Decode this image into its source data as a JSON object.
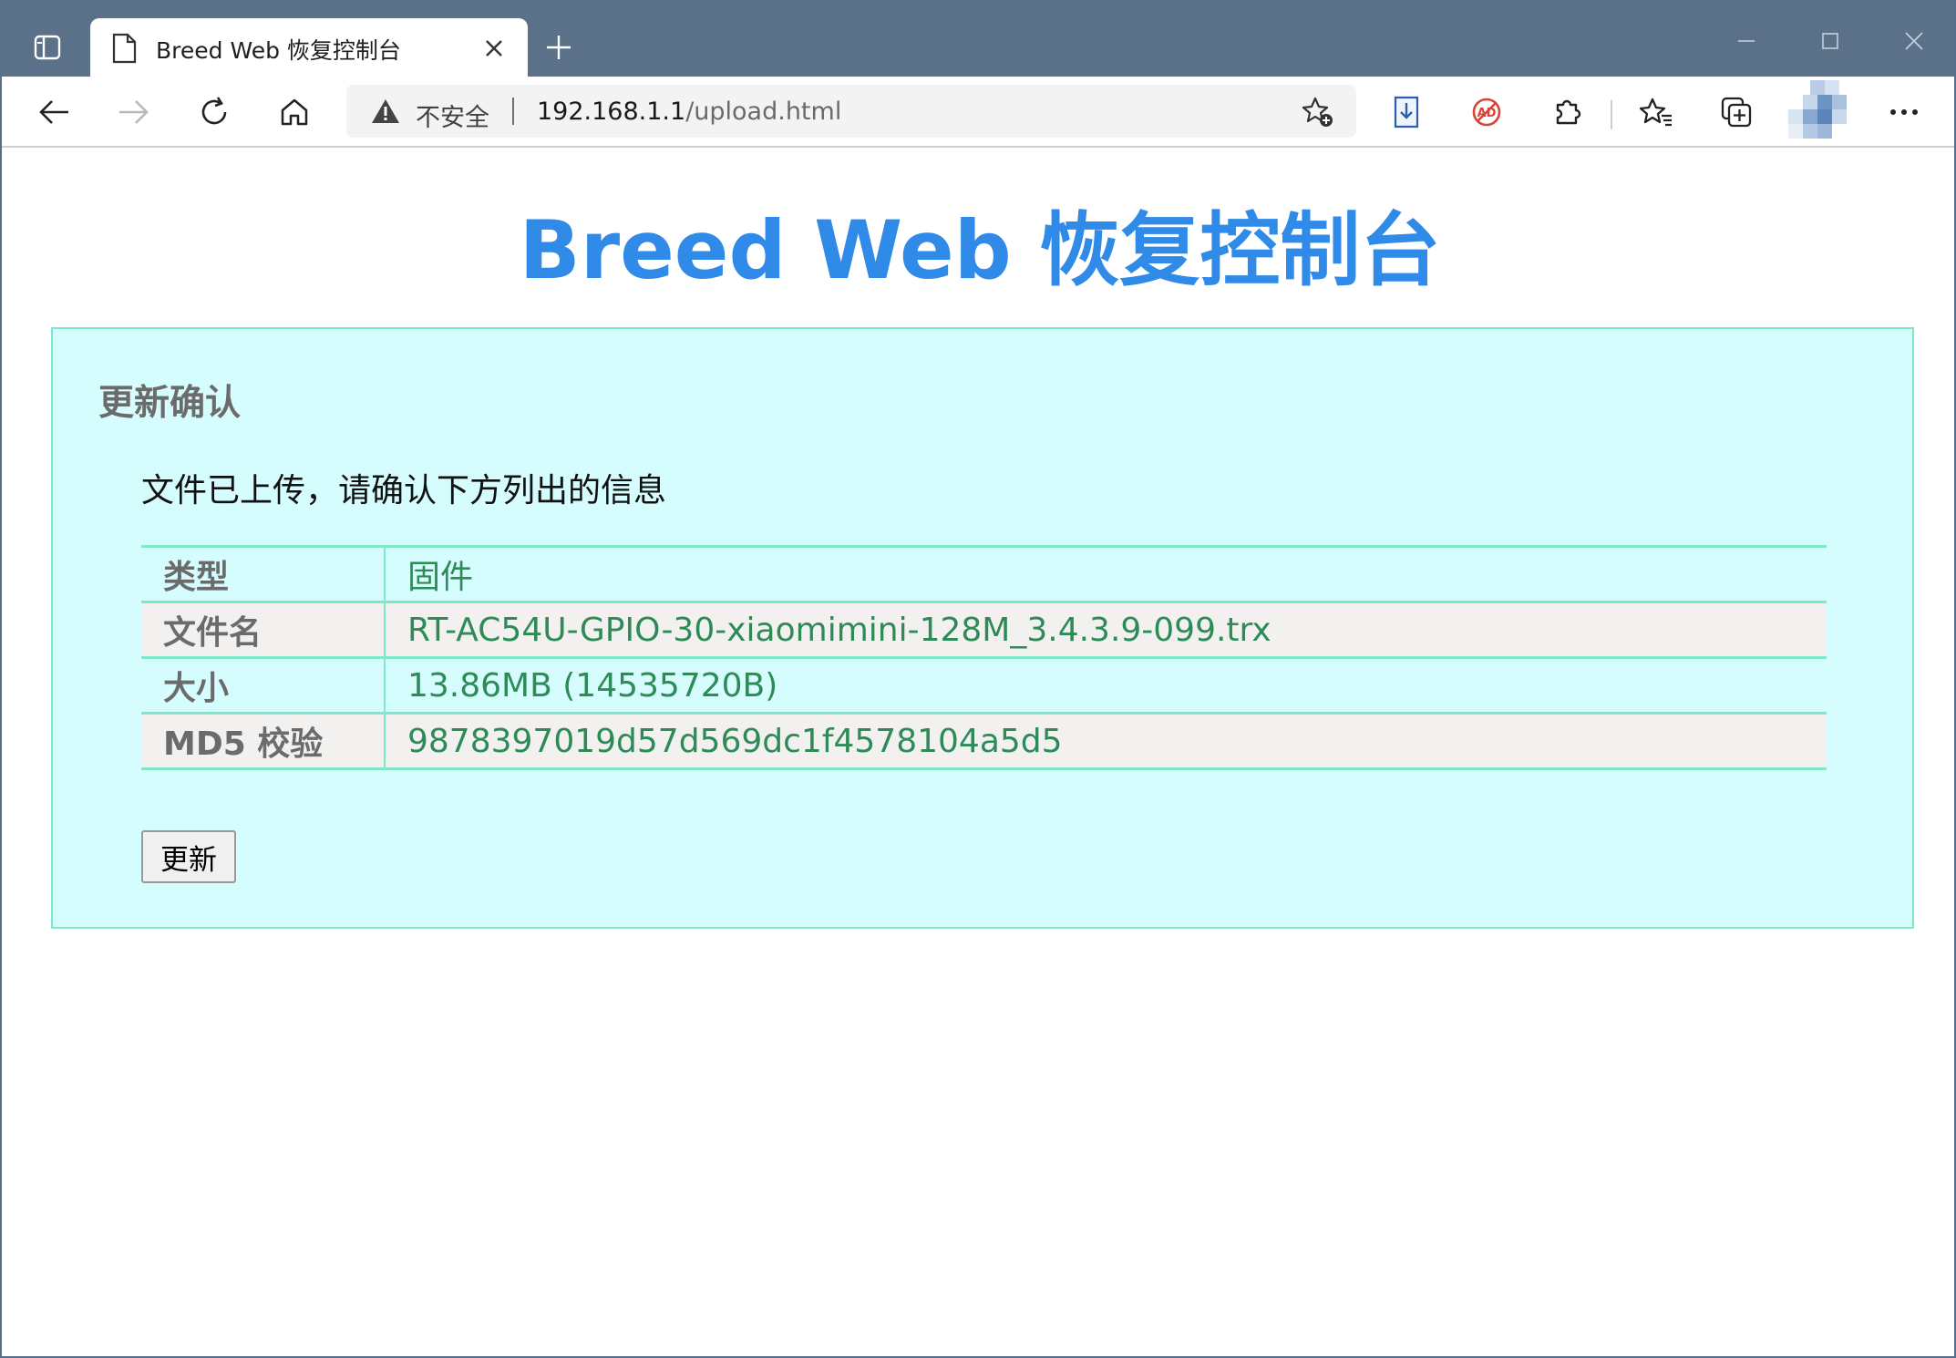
{
  "browser": {
    "tab": {
      "title": "Breed Web 恢复控制台"
    },
    "address": {
      "security_label": "不安全",
      "url_host": "192.168.1.1",
      "url_path": "/upload.html"
    }
  },
  "page": {
    "title": "Breed Web 恢复控制台",
    "panel": {
      "heading": "更新确认",
      "description": "文件已上传，请确认下方列出的信息",
      "rows": [
        {
          "label": "类型",
          "value": "固件"
        },
        {
          "label": "文件名",
          "value": "RT-AC54U-GPIO-30-xiaomimini-128M_3.4.3.9-099.trx"
        },
        {
          "label": "大小",
          "value": "13.86MB (14535720B)"
        },
        {
          "label": "MD5 校验",
          "value": "9878397019d57d569dc1f4578104a5d5"
        }
      ],
      "update_button": "更新"
    }
  },
  "colors": {
    "title_blue": "#2f8ae8",
    "panel_background": "#d6fdfd",
    "panel_border": "#7ee8c8",
    "value_green": "#2e8b57",
    "label_gray": "#6b6b6b",
    "tabstrip": "#5b7089"
  }
}
